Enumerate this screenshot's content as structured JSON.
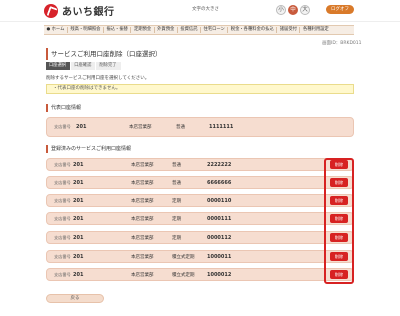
{
  "header": {
    "bank_name": "あいち銀行",
    "font_size_label": "文字の大きさ",
    "font_sizes": [
      "小",
      "中",
      "大"
    ],
    "logout_label": "ログオフ"
  },
  "nav": {
    "items": [
      "ホーム",
      "残高・明細照会",
      "振込・振替",
      "定期預金",
      "外貨預金",
      "投資信託",
      "住宅ローン",
      "税金・各種料金の払込",
      "諸届受付",
      "各種利用設定"
    ]
  },
  "screen_id": "画面ID：BRKD011",
  "page_title": "サービスご利用口座削除（口座選択）",
  "steps": [
    "口座選択",
    "口座確認",
    "削除完了"
  ],
  "instruction": "削除するサービスご利用口座を選択してください。",
  "warning": "代表口座の削除はできません。",
  "representative": {
    "title": "代表口座情報",
    "label": "支店番号",
    "branch_no": "201",
    "branch_name": "本店営業部",
    "type": "普通",
    "account": "1111111"
  },
  "registered": {
    "title": "登録済みのサービスご利用口座情報",
    "label": "支店番号",
    "delete_label": "削除",
    "rows": [
      {
        "branch_no": "201",
        "branch_name": "本店営業部",
        "type": "普通",
        "account": "2222222"
      },
      {
        "branch_no": "201",
        "branch_name": "本店営業部",
        "type": "普通",
        "account": "6666666"
      },
      {
        "branch_no": "201",
        "branch_name": "本店営業部",
        "type": "定期",
        "account": "0000110"
      },
      {
        "branch_no": "201",
        "branch_name": "本店営業部",
        "type": "定期",
        "account": "0000111"
      },
      {
        "branch_no": "201",
        "branch_name": "本店営業部",
        "type": "定期",
        "account": "0000112"
      },
      {
        "branch_no": "201",
        "branch_name": "本店営業部",
        "type": "積立式定期",
        "account": "1000011"
      },
      {
        "branch_no": "201",
        "branch_name": "本店営業部",
        "type": "積立式定期",
        "account": "1000012"
      }
    ]
  },
  "back_label": "戻る",
  "colors": {
    "accent": "#c85a3c",
    "delete": "#d72222",
    "row_bg": "#f6ddd0"
  }
}
